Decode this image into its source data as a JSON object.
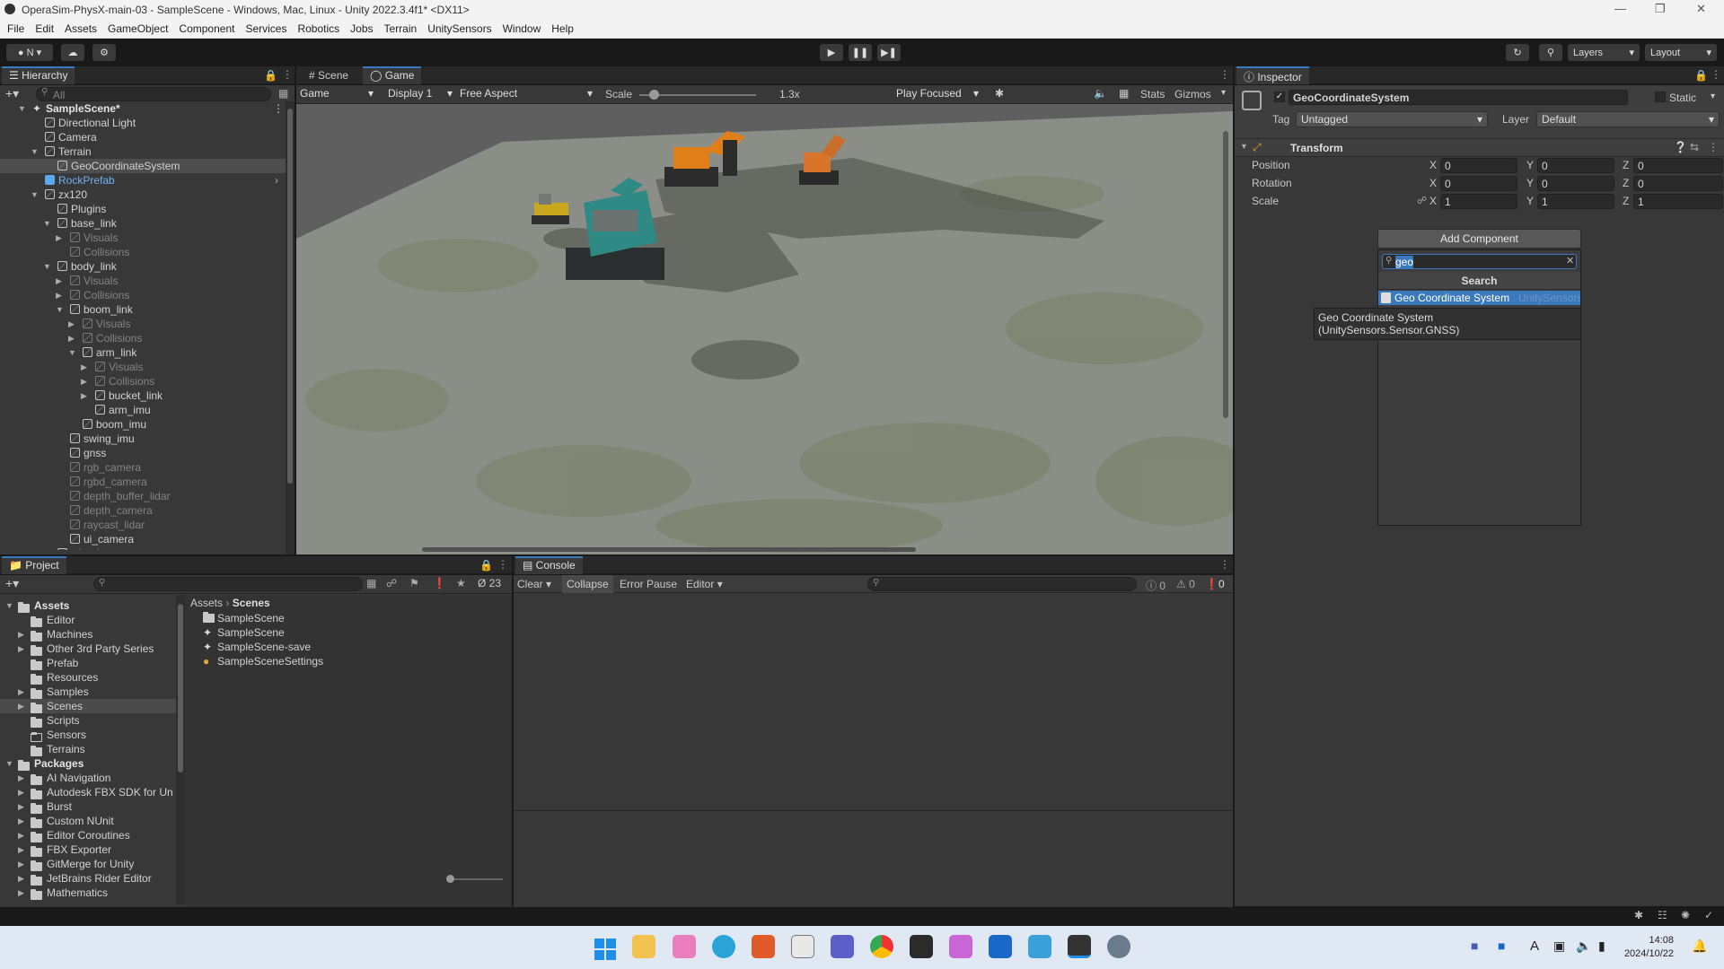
{
  "window": {
    "title": "OperaSim-PhysX-main-03 - SampleScene - Windows, Mac, Linux - Unity 2022.3.4f1* <DX11>"
  },
  "menu": [
    "File",
    "Edit",
    "Assets",
    "GameObject",
    "Component",
    "Services",
    "Robotics",
    "Jobs",
    "Terrain",
    "UnitySensors",
    "Window",
    "Help"
  ],
  "toolbar": {
    "account": "N",
    "layers": "Layers",
    "layout": "Layout"
  },
  "hierarchy": {
    "title": "Hierarchy",
    "search_placeholder": "All",
    "items": [
      {
        "label": "SampleScene*",
        "depth": 0,
        "bold": true,
        "scene": true,
        "arrow": "down"
      },
      {
        "label": "Directional Light",
        "depth": 1
      },
      {
        "label": "Camera",
        "depth": 1
      },
      {
        "label": "Terrain",
        "depth": 1,
        "arrow": "down"
      },
      {
        "label": "GeoCoordinateSystem",
        "depth": 2,
        "selected": true
      },
      {
        "label": "RockPrefab",
        "depth": 1,
        "prefab": true,
        "chevron": true
      },
      {
        "label": "zx120",
        "depth": 1,
        "arrow": "down"
      },
      {
        "label": "Plugins",
        "depth": 2
      },
      {
        "label": "base_link",
        "depth": 2,
        "arrow": "down"
      },
      {
        "label": "Visuals",
        "depth": 3,
        "dim": true,
        "arrow": "right"
      },
      {
        "label": "Collisions",
        "depth": 3,
        "dim": true
      },
      {
        "label": "body_link",
        "depth": 2,
        "arrow": "down"
      },
      {
        "label": "Visuals",
        "depth": 3,
        "dim": true,
        "arrow": "right"
      },
      {
        "label": "Collisions",
        "depth": 3,
        "dim": true,
        "arrow": "right"
      },
      {
        "label": "boom_link",
        "depth": 3,
        "arrow": "down"
      },
      {
        "label": "Visuals",
        "depth": 4,
        "dim": true,
        "arrow": "right"
      },
      {
        "label": "Collisions",
        "depth": 4,
        "dim": true,
        "arrow": "right"
      },
      {
        "label": "arm_link",
        "depth": 4,
        "arrow": "down"
      },
      {
        "label": "Visuals",
        "depth": 5,
        "dim": true,
        "arrow": "right"
      },
      {
        "label": "Collisions",
        "depth": 5,
        "dim": true,
        "arrow": "right"
      },
      {
        "label": "bucket_link",
        "depth": 5,
        "arrow": "right"
      },
      {
        "label": "arm_imu",
        "depth": 5
      },
      {
        "label": "boom_imu",
        "depth": 4
      },
      {
        "label": "swing_imu",
        "depth": 3
      },
      {
        "label": "gnss",
        "depth": 3
      },
      {
        "label": "rgb_camera",
        "depth": 3,
        "dim": true
      },
      {
        "label": "rgbd_camera",
        "depth": 3,
        "dim": true
      },
      {
        "label": "depth_buffer_lidar",
        "depth": 3,
        "dim": true
      },
      {
        "label": "depth_camera",
        "depth": 3,
        "dim": true
      },
      {
        "label": "raycast_lidar",
        "depth": 3,
        "dim": true
      },
      {
        "label": "ui_camera",
        "depth": 3
      },
      {
        "label": "wheels",
        "depth": 2,
        "arrow": "right"
      }
    ]
  },
  "scene": {
    "tabs": [
      "Scene",
      "Game"
    ],
    "game_label": "Game",
    "display": "Display 1",
    "aspect": "Free Aspect",
    "scale_label": "Scale",
    "scale_value": "1.3x",
    "scale_level": 0.12,
    "play_mode": "Play Focused",
    "stats": "Stats",
    "gizmos": "Gizmos"
  },
  "inspector": {
    "title": "Inspector",
    "object_name": "GeoCoordinateSystem",
    "static_label": "Static",
    "tag_label": "Tag",
    "tag_value": "Untagged",
    "layer_label": "Layer",
    "layer_value": "Default",
    "component": "Transform",
    "rows": [
      {
        "label": "Position",
        "x": "0",
        "y": "0",
        "z": "0"
      },
      {
        "label": "Rotation",
        "x": "0",
        "y": "0",
        "z": "0"
      },
      {
        "label": "Scale",
        "x": "1",
        "y": "1",
        "z": "1"
      }
    ],
    "axis": {
      "x": "X",
      "y": "Y",
      "z": "Z"
    },
    "add_component": "Add Component",
    "search_value": "geo",
    "search_header": "Search",
    "result": "Geo Coordinate System",
    "result_ns": "UnitySensors",
    "tooltip_line1": "Geo Coordinate System",
    "tooltip_line2": "(UnitySensors.Sensor.GNSS)"
  },
  "project": {
    "title": "Project",
    "hidden_count": "23",
    "breadcrumb": [
      "Assets",
      "Scenes"
    ],
    "tree": [
      {
        "label": "Assets",
        "bold": true,
        "depth": 0,
        "arrow": "down"
      },
      {
        "label": "Editor",
        "depth": 1
      },
      {
        "label": "Machines",
        "depth": 1,
        "arrow": "right"
      },
      {
        "label": "Other 3rd Party Series",
        "depth": 1,
        "arrow": "right"
      },
      {
        "label": "Prefab",
        "depth": 1
      },
      {
        "label": "Resources",
        "depth": 1
      },
      {
        "label": "Samples",
        "depth": 1,
        "arrow": "right"
      },
      {
        "label": "Scenes",
        "depth": 1,
        "arrow": "right",
        "selected": true
      },
      {
        "label": "Scripts",
        "depth": 1
      },
      {
        "label": "Sensors",
        "depth": 1,
        "empty": true
      },
      {
        "label": "Terrains",
        "depth": 1
      },
      {
        "label": "Packages",
        "bold": true,
        "depth": 0,
        "arrow": "down"
      },
      {
        "label": "AI Navigation",
        "depth": 1,
        "arrow": "right"
      },
      {
        "label": "Autodesk FBX SDK for Un",
        "depth": 1,
        "arrow": "right"
      },
      {
        "label": "Burst",
        "depth": 1,
        "arrow": "right"
      },
      {
        "label": "Custom NUnit",
        "depth": 1,
        "arrow": "right"
      },
      {
        "label": "Editor Coroutines",
        "depth": 1,
        "arrow": "right"
      },
      {
        "label": "FBX Exporter",
        "depth": 1,
        "arrow": "right"
      },
      {
        "label": "GitMerge for Unity",
        "depth": 1,
        "arrow": "right"
      },
      {
        "label": "JetBrains Rider Editor",
        "depth": 1,
        "arrow": "right"
      },
      {
        "label": "Mathematics",
        "depth": 1,
        "arrow": "right"
      }
    ],
    "files": [
      {
        "label": "SampleScene",
        "type": "folder"
      },
      {
        "label": "SampleScene",
        "type": "unity"
      },
      {
        "label": "SampleScene-save",
        "type": "unity"
      },
      {
        "label": "SampleSceneSettings",
        "type": "settings"
      }
    ]
  },
  "console": {
    "title": "Console",
    "clear": "Clear",
    "collapse": "Collapse",
    "error_pause": "Error Pause",
    "editor": "Editor",
    "info": "0",
    "warn": "0",
    "err": "0"
  },
  "tray": {
    "time": "14:08",
    "date": "2024/10/22",
    "ime": "A"
  }
}
